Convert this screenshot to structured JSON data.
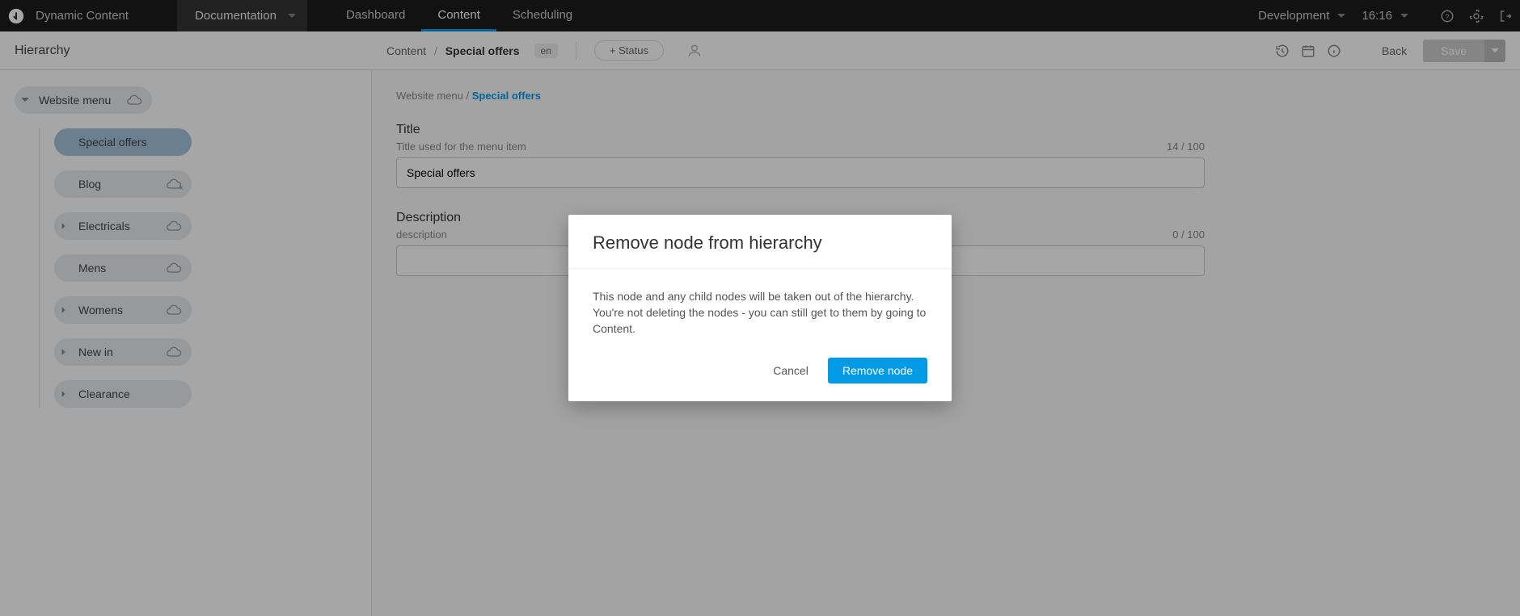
{
  "header": {
    "app_name": "Dynamic Content",
    "hub_label": "Documentation",
    "tabs": [
      "Dashboard",
      "Content",
      "Scheduling"
    ],
    "active_tab_index": 1,
    "environment_label": "Development",
    "clock_text": "16:16"
  },
  "subbar": {
    "left_panel_title": "Hierarchy",
    "crumb_root": "Content",
    "crumb_current": "Special offers",
    "locale_badge": "en",
    "status_button_label": "+ Status",
    "back_label": "Back",
    "save_label": "Save"
  },
  "tree": {
    "root_label": "Website menu",
    "items": [
      {
        "label": "Special offers",
        "has_children": false,
        "active": true,
        "cloud_variant": "none"
      },
      {
        "label": "Blog",
        "has_children": false,
        "active": false,
        "cloud_variant": "cloud-x"
      },
      {
        "label": "Electricals",
        "has_children": true,
        "active": false,
        "cloud_variant": "cloud"
      },
      {
        "label": "Mens",
        "has_children": false,
        "active": false,
        "cloud_variant": "cloud"
      },
      {
        "label": "Womens",
        "has_children": true,
        "active": false,
        "cloud_variant": "cloud"
      },
      {
        "label": "New in",
        "has_children": true,
        "active": false,
        "cloud_variant": "cloud"
      },
      {
        "label": "Clearance",
        "has_children": true,
        "active": false,
        "cloud_variant": "none"
      }
    ]
  },
  "breadcrumb_mini": {
    "root": "Website menu",
    "current": "Special offers"
  },
  "form": {
    "title": {
      "label": "Title",
      "hint": "Title used for the menu item",
      "count_text": "14 / 100",
      "value": "Special offers"
    },
    "description": {
      "label": "Description",
      "hint": "description",
      "count_text": "0 / 100",
      "value": "",
      "placeholder": ""
    }
  },
  "modal": {
    "title": "Remove node from hierarchy",
    "body": "This node and any child nodes will be taken out of the hierarchy. You're not deleting the nodes - you can still get to them by going to Content.",
    "cancel_label": "Cancel",
    "confirm_label": "Remove node"
  },
  "icons": {
    "chevron_down": "chevron-down-icon",
    "logo": "amp-logo-icon",
    "help": "help-icon",
    "gear": "gear-icon",
    "logout": "logout-icon",
    "history": "history-icon",
    "calendar": "calendar-icon",
    "info": "info-icon",
    "person": "person-icon",
    "cloud": "cloud-icon",
    "cloud_x": "cloud-off-icon",
    "tree_collapse": "chevron-down-icon",
    "tree_expand": "chevron-right-icon"
  }
}
